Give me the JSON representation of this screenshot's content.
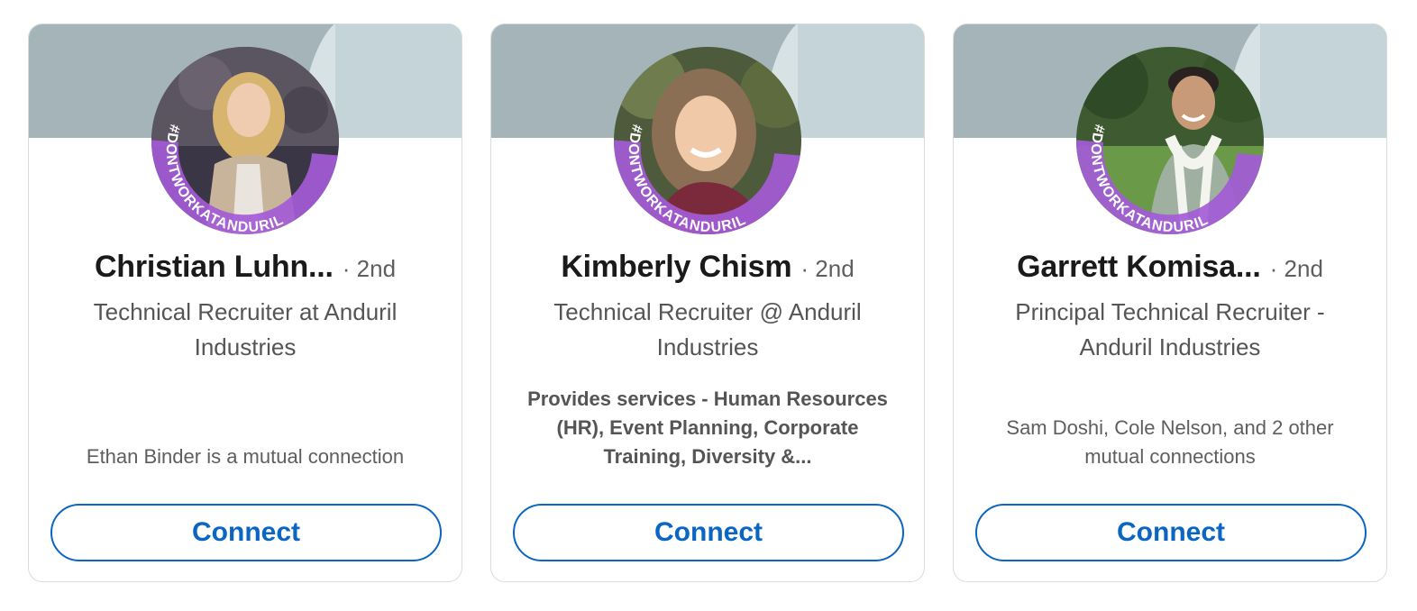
{
  "cards": [
    {
      "name": "Christian Luhn...",
      "degree": "· 2nd",
      "headline": "Technical Recruiter at Anduril Industries",
      "insight": "Ethan Binder is a mutual connection",
      "frame_text": "#DONTWORKATANDURIL",
      "connect_label": "Connect"
    },
    {
      "name": "Kimberly Chism",
      "degree": "· 2nd",
      "headline": "Technical Recruiter @ Anduril Industries",
      "insight": "Provides services - Human Resources (HR), Event Planning, Corporate Training, Diversity &...",
      "frame_text": "#DONTWORKATANDURIL",
      "connect_label": "Connect"
    },
    {
      "name": "Garrett Komisa...",
      "degree": "· 2nd",
      "headline": "Principal Technical Recruiter - Anduril Industries",
      "insight": "Sam Doshi, Cole Nelson, and 2 other mutual connections",
      "frame_text": "#DONTWORKATANDURIL",
      "connect_label": "Connect"
    }
  ],
  "colors": {
    "accent": "#0a66c2",
    "banner_dark": "#a4b4b8",
    "banner_light": "#c5d4d8",
    "frame_purple": "#a35bd6"
  }
}
